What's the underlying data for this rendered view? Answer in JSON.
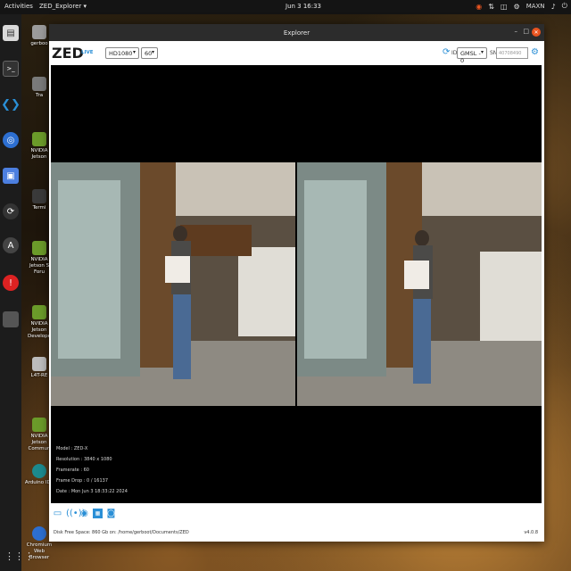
{
  "topbar": {
    "activities": "Activities",
    "app_menu": "ZED_Explorer ▾",
    "clock": "Jun 3  16:33",
    "power_mode": "MAXN"
  },
  "dock": {
    "items": [
      "files",
      "terminal",
      "vscode",
      "chromium",
      "screenshot",
      "editor",
      "arduino",
      "recovery",
      "terminal-2"
    ]
  },
  "desktop": {
    "icons": [
      {
        "label": "gerboo"
      },
      {
        "label": "Tra"
      },
      {
        "label": "NVIDIA Jetson"
      },
      {
        "label": "Termi"
      },
      {
        "label": "NVIDIA Jetson S Foru"
      },
      {
        "label": "NVIDIA Jetson Develope"
      },
      {
        "label": "L4T-RE"
      },
      {
        "label": "NVIDIA Jetson Commun"
      },
      {
        "label": "Arduino IDE"
      },
      {
        "label": "Chromium Web Browser"
      }
    ]
  },
  "window": {
    "title": "Explorer",
    "logo": "ZED",
    "live_badge": "LIVE",
    "resolution": "HD1080",
    "fps": "60",
    "id_label": "ID",
    "camera_id": "GMSL - 0",
    "sn_label": "SN",
    "sn_placeholder": "40708490",
    "info": {
      "model": "Model : ZED-X",
      "resolution": "Resolution : 3840 x 1080",
      "framerate": "Framerate : 60",
      "frame_drop": "Frame Drop : 0 / 16137",
      "date": "Date : Mon Jun 3 18:33:22 2024"
    },
    "footer": {
      "disk": "Disk Free Space: 860 Gb  on: /home/gerboot/Documents/ZED",
      "version": "v4.0.8"
    }
  },
  "colors": {
    "accent": "#2a8fd6",
    "close": "#e95420",
    "titlebar": "#2c2c2c",
    "viewport": "#000000"
  }
}
